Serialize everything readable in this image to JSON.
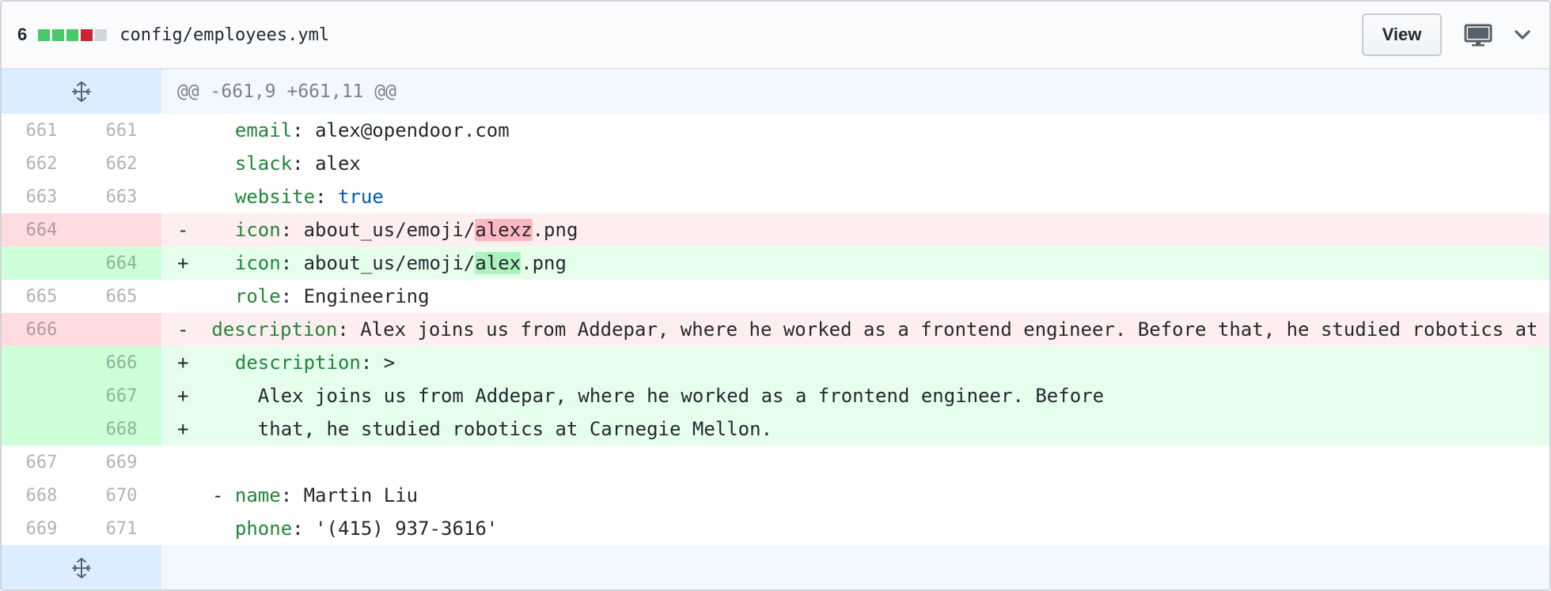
{
  "header": {
    "diffstat_count": "6",
    "diffstat_blocks": [
      "added",
      "added",
      "added",
      "deleted",
      "neutral"
    ],
    "file_path": "config/employees.yml",
    "view_label": "View",
    "display_icon": "desktop-display-icon",
    "chevron_icon": "chevron-down-icon"
  },
  "hunk": {
    "header": "@@ -661,9 +661,11 @@",
    "expand_icon": "unfold-icon"
  },
  "lines": [
    {
      "old": "661",
      "new": "661",
      "type": "ctx",
      "marker": "",
      "key": "email",
      "sep": ": ",
      "value": "alex@opendoor.com",
      "indent": "  "
    },
    {
      "old": "662",
      "new": "662",
      "type": "ctx",
      "marker": "",
      "key": "slack",
      "sep": ": ",
      "value": "alex",
      "indent": "  "
    },
    {
      "old": "663",
      "new": "663",
      "type": "ctx",
      "marker": "",
      "key": "website",
      "sep": ": ",
      "value": "true",
      "indent": "  "
    },
    {
      "old": "664",
      "new": "",
      "type": "del",
      "marker": "-",
      "key": "icon",
      "sep": ": ",
      "pre": "about_us/emoji/",
      "hl": "alexz",
      "post": ".png",
      "indent": "  "
    },
    {
      "old": "",
      "new": "664",
      "type": "add",
      "marker": "+",
      "key": "icon",
      "sep": ": ",
      "pre": "about_us/emoji/",
      "hl": "alex",
      "post": ".png",
      "indent": "  "
    },
    {
      "old": "665",
      "new": "665",
      "type": "ctx",
      "marker": "",
      "key": "role",
      "sep": ": ",
      "value": "Engineering",
      "indent": "  "
    },
    {
      "old": "666",
      "new": "",
      "type": "del",
      "marker": "-",
      "key": "description",
      "sep": ": ",
      "value": "Alex joins us from Addepar, where he worked as a frontend engineer. Before that, he studied robotics at C",
      "indent": "  "
    },
    {
      "old": "",
      "new": "666",
      "type": "add",
      "marker": "+",
      "key": "description",
      "sep": ": ",
      "value": ">",
      "indent": "  "
    },
    {
      "old": "",
      "new": "667",
      "type": "add",
      "marker": "+",
      "key": "",
      "sep": "",
      "value": "Alex joins us from Addepar, where he worked as a frontend engineer. Before",
      "indent": "    "
    },
    {
      "old": "",
      "new": "668",
      "type": "add",
      "marker": "+",
      "key": "",
      "sep": "",
      "value": "that, he studied robotics at Carnegie Mellon.",
      "indent": "    "
    },
    {
      "old": "667",
      "new": "669",
      "type": "ctx",
      "marker": "",
      "key": "",
      "sep": "",
      "value": "",
      "indent": ""
    },
    {
      "old": "668",
      "new": "670",
      "type": "ctx",
      "marker": "",
      "key": "name",
      "sep": ": ",
      "value": "Martin Liu",
      "indent": "- "
    },
    {
      "old": "669",
      "new": "671",
      "type": "ctx",
      "marker": "",
      "key": "phone",
      "sep": ": ",
      "value": "'(415) 937-3616'",
      "indent": "  "
    }
  ],
  "colors": {
    "deleted": "#cb2431",
    "added": "#2cbe4e",
    "key": "#22863a",
    "boolean": "#005cc5"
  }
}
